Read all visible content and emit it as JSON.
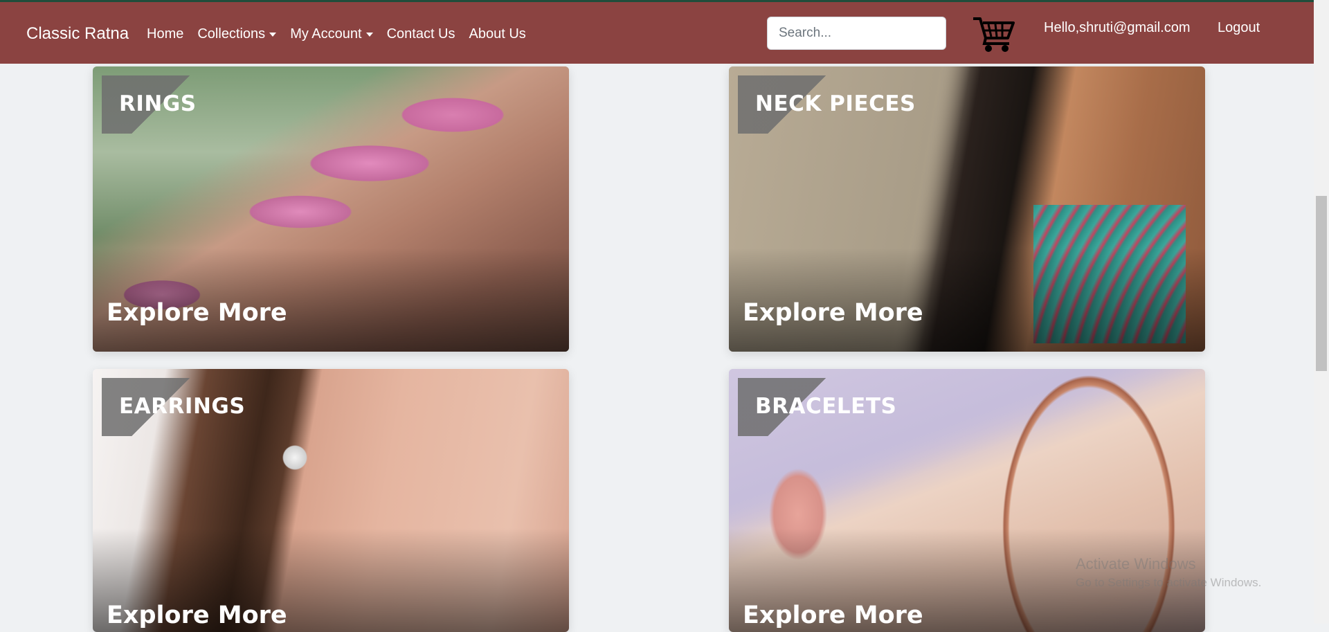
{
  "navbar": {
    "brand": "Classic Ratna",
    "links": [
      {
        "label": "Home",
        "dropdown": false
      },
      {
        "label": "Collections",
        "dropdown": true
      },
      {
        "label": "My Account",
        "dropdown": true
      },
      {
        "label": "Contact Us",
        "dropdown": false
      },
      {
        "label": "About Us",
        "dropdown": false
      }
    ],
    "search_placeholder": "Search...",
    "cart_icon": "shopping-cart-icon",
    "greeting": "Hello,shruti@gmail.com",
    "logout_label": "Logout",
    "bg_color": "#8b4341"
  },
  "categories": [
    {
      "title": "RINGS",
      "cta": "Explore More"
    },
    {
      "title": "NECK PIECES",
      "cta": "Explore More"
    },
    {
      "title": "EARRINGS",
      "cta": "Explore More"
    },
    {
      "title": "BRACELETS",
      "cta": "Explore More"
    }
  ],
  "watermark": {
    "line1": "Activate Windows",
    "line2": "Go to Settings to activate Windows."
  }
}
